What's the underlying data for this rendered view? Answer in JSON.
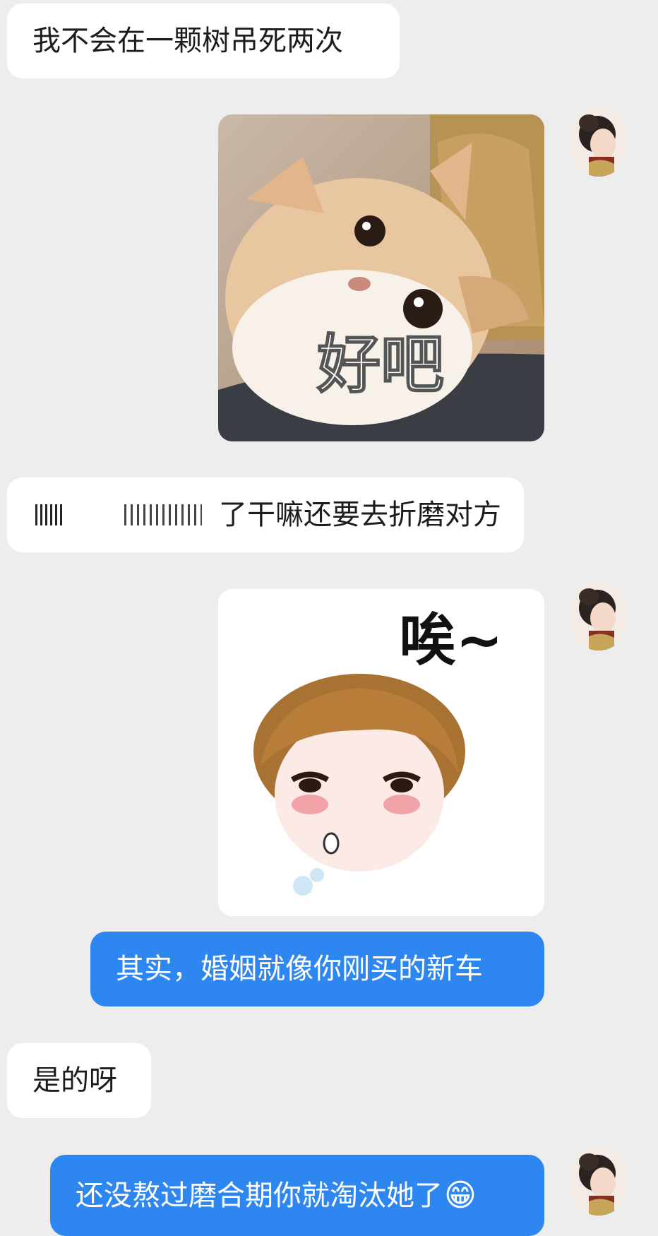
{
  "messages": [
    {
      "id": "m1",
      "side": "left",
      "type": "text",
      "text": "我不会在一颗树吊死两次"
    },
    {
      "id": "m2",
      "side": "right",
      "type": "sticker",
      "caption": "好吧",
      "icon": "cat-sticker-icon"
    },
    {
      "id": "m3",
      "side": "left",
      "type": "text",
      "text": "了干嘛还要去折磨对方",
      "redacted_prefix": true
    },
    {
      "id": "m4",
      "side": "right",
      "type": "sticker",
      "caption": "唉~",
      "icon": "sigh-girl-sticker-icon"
    },
    {
      "id": "m5",
      "side": "right",
      "type": "text",
      "text": "其实，婚姻就像你刚买的新车"
    },
    {
      "id": "m6",
      "side": "left",
      "type": "text",
      "text": "是的呀"
    },
    {
      "id": "m7",
      "side": "right",
      "type": "text",
      "text": "还没熬过磨合期你就淘汰她了",
      "emoji": "😁"
    }
  ],
  "colors": {
    "background": "#ededed",
    "incoming_bubble": "#ffffff",
    "outgoing_bubble": "#2e87f0"
  },
  "avatar": {
    "icon": "user-avatar-icon"
  }
}
